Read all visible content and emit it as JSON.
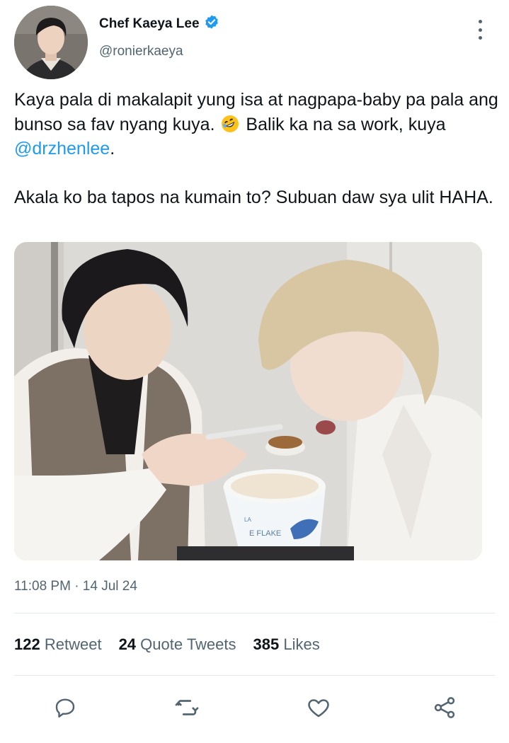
{
  "author": {
    "display_name": "Chef Kaeya Lee",
    "handle": "@ronierkaeya",
    "verified": true,
    "avatar_icon": "profile-photo"
  },
  "tweet": {
    "line1_before": "Kaya pala di makalapit yung isa at nagpapa-baby pa pala ang bunso sa fav nyang kuya.",
    "emoji": "rolling-on-floor-laughing-emoji",
    "line1_after": " Balik ka na sa work, kuya ",
    "mention": "@drzhenlee",
    "line1_end": ".",
    "paragraph2": "Akala ko ba tapos na kumain to? Subuan daw sya ulit HAHA."
  },
  "media": {
    "cup_text": "E FLAKE",
    "cup_brand": "LA"
  },
  "timestamp": "11:08 PM · 14 Jul 24",
  "stats": {
    "retweets_count": "122",
    "retweets_label": "Retweet",
    "quotes_count": "24",
    "quotes_label": "Quote Tweets",
    "likes_count": "385",
    "likes_label": "Likes"
  },
  "actions": [
    "reply-icon",
    "retweet-icon",
    "like-icon",
    "share-icon"
  ],
  "colors": {
    "accent": "#1d9bf0",
    "text": "#0f1419",
    "secondary": "#536471",
    "divider": "#e6e9ec"
  }
}
